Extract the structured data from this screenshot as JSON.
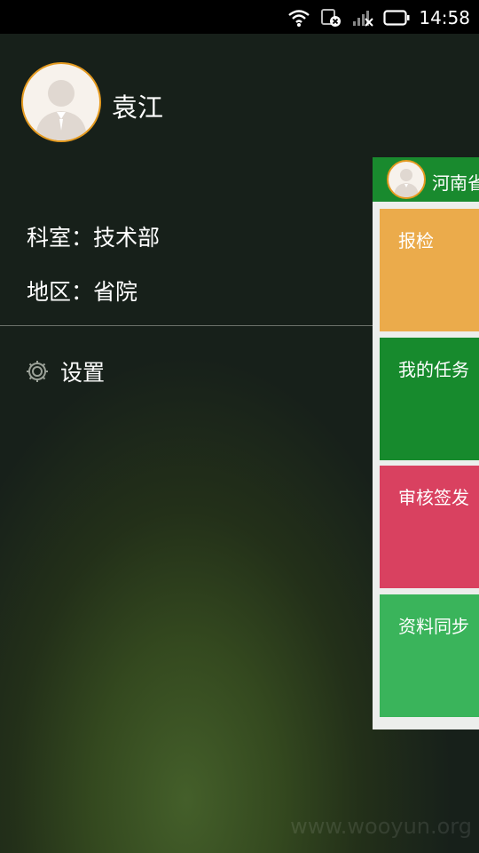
{
  "status_bar": {
    "time": "14:58",
    "icons": [
      "wifi-icon",
      "vpn-blocked-icon",
      "signal-off-icon",
      "battery-icon"
    ]
  },
  "drawer": {
    "username": "袁江",
    "department_line": "科室：技术部",
    "region_line": "地区：省院",
    "settings_label": "设置",
    "settings_icon": "gear-icon"
  },
  "main": {
    "header_title": "河南省",
    "tiles": [
      {
        "label": "报检",
        "color": "#ebab4b"
      },
      {
        "label": "我的任务",
        "color": "#178a2d"
      },
      {
        "label": "审核签发",
        "color": "#d94160"
      },
      {
        "label": "资料同步",
        "color": "#3ab45b"
      }
    ]
  },
  "watermark": "www.wooyun.org"
}
